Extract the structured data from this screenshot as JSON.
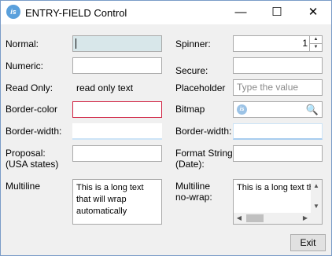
{
  "window": {
    "title": "ENTRY-FIELD Control",
    "icon_text": "is",
    "minimize_glyph": "—",
    "maximize_glyph": "☐",
    "close_glyph": "✕"
  },
  "labels": {
    "normal": "Normal:",
    "numeric": "Numeric:",
    "read_only": "Read Only:",
    "border_color": "Border-color",
    "border_width_left": "Border-width:",
    "proposal_line1": "Proposal:",
    "proposal_line2": "(USA states)",
    "multiline": "Multiline",
    "spinner": "Spinner:",
    "secure": "Secure:",
    "placeholder": "Placeholder",
    "bitmap": "Bitmap",
    "border_width_right": "Border-width:",
    "format_string_line1": "Format String",
    "format_string_line2": "(Date):",
    "multiline_nowrap_line1": "Multiline",
    "multiline_nowrap_line2": "no-wrap:"
  },
  "fields": {
    "normal_value": "",
    "numeric_value": "",
    "read_only_value": "read only text",
    "border_color_value": "",
    "border_width_left_value": "",
    "proposal_value": "",
    "spinner_value": "1",
    "spinner_up_glyph": "▲",
    "spinner_down_glyph": "▼",
    "secure_value": "",
    "placeholder_text": "Type the value",
    "bitmap_icon_text": "is",
    "bitmap_search_glyph": "🔍",
    "border_width_right_value": "",
    "format_string_value": "",
    "multiline_text": "This is a long text that will wrap automatically",
    "multiline_nowrap_text": "This is a long text th"
  },
  "scroll": {
    "up_glyph": "▲",
    "down_glyph": "▼",
    "left_glyph": "◀",
    "right_glyph": "▶"
  },
  "buttons": {
    "exit_label": "Exit"
  },
  "colors": {
    "focused_field_bg": "#d8e7ea",
    "error_border": "#d02040",
    "border_width_accent": "#a8cdef"
  }
}
